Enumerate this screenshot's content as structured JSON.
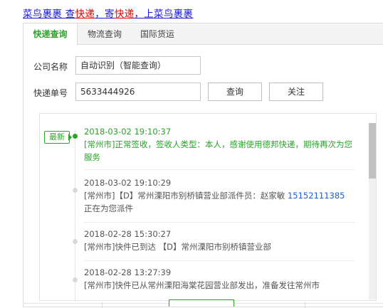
{
  "promo": {
    "part1": "菜鸟裹裹 查",
    "part2": "快递",
    "part3": "，寄",
    "part4": "快递",
    "part5": "，上菜鸟裹裹"
  },
  "tabs": [
    {
      "label": "快递查询"
    },
    {
      "label": "物流查询"
    },
    {
      "label": "国际货运"
    }
  ],
  "form": {
    "company_label": "公司名称",
    "company_value": "自动识别（智能查询）",
    "number_label": "快递单号",
    "number_value": "5633444926",
    "query_button": "查询",
    "follow_button": "关注"
  },
  "results": {
    "latest_badge": "最新",
    "entries": [
      {
        "time": "2018-03-02 19:10:37",
        "desc": "[常州市]正常签收，签收人类型：本人，感谢使用德邦快递，期待再次为您服务"
      },
      {
        "time": "2018-03-02 19:10:29",
        "desc_prefix": "[常州市]【D】常州溧阳市别桥镇营业部派件员：赵家敏 ",
        "phone": "15152111385",
        "desc_suffix": "正在为您派件"
      },
      {
        "time": "2018-02-28 15:30:27",
        "desc": "[常州市]快件已到达 【D】常州溧阳市别桥镇营业部"
      },
      {
        "time": "2018-02-28 13:27:39",
        "desc": "[常州市]快件已从常州溧阳海棠花园营业部发出，准备发往常州市"
      }
    ]
  },
  "colors": {
    "accent_green": "#2aa52a",
    "link_blue": "#1a1ad6",
    "highlight_red": "#e00000",
    "phone_blue": "#1a5fd6"
  }
}
